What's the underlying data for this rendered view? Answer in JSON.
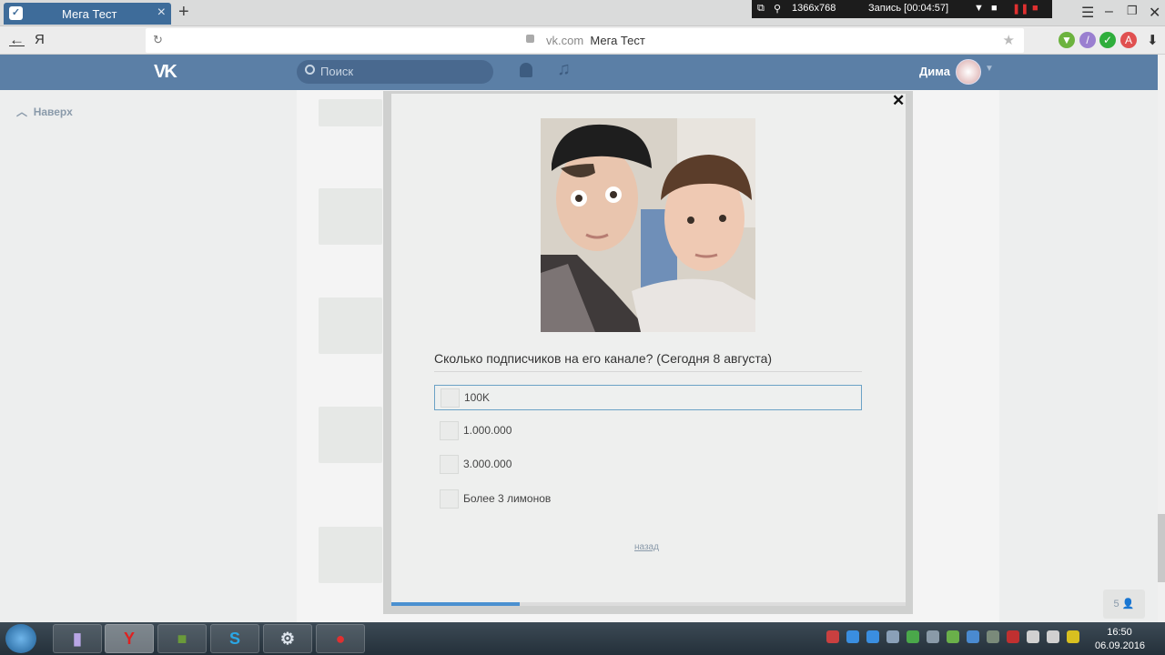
{
  "browser": {
    "tab_title": "Мега Тест",
    "tab_favicon": "vk-shield-icon",
    "new_tab_symbol": "+",
    "tab_close_symbol": "×",
    "back_symbol": "←",
    "yandex_letter": "Я",
    "reload_symbol": "↻",
    "url_domain": "vk.com",
    "url_title": "Мега Тест",
    "bookmark_symbol": "★",
    "download_symbol": "⬇"
  },
  "recorder": {
    "resolution": "1366x768",
    "status": "Запись [00:04:57]"
  },
  "vk": {
    "logo": "VK",
    "search_placeholder": "Поиск",
    "user_name": "Дима",
    "up_link": "Наверх",
    "counter": "5"
  },
  "quiz": {
    "question": "Сколько подписчиков на его канале? (Сегодня 8 августа)",
    "options": [
      {
        "label": "100K",
        "selected": true
      },
      {
        "label": "1.000.000",
        "selected": false
      },
      {
        "label": "3.000.000",
        "selected": false
      },
      {
        "label": "Более 3 лимонов",
        "selected": false
      }
    ],
    "back_link": "назад",
    "close_symbol": "✕",
    "progress_fraction": 0.25
  },
  "taskbar": {
    "time": "16:50",
    "date": "06.09.2016",
    "apps": [
      "app-icon",
      "yandex-browser-icon",
      "minecraft-icon",
      "skype-icon",
      "steam-icon",
      "record-app-icon"
    ]
  },
  "colors": {
    "vk_header": "#5b7fa6",
    "tab_active": "#3e6c9a",
    "progress": "#4a90d0",
    "selected_border": "#6ba2c6"
  }
}
